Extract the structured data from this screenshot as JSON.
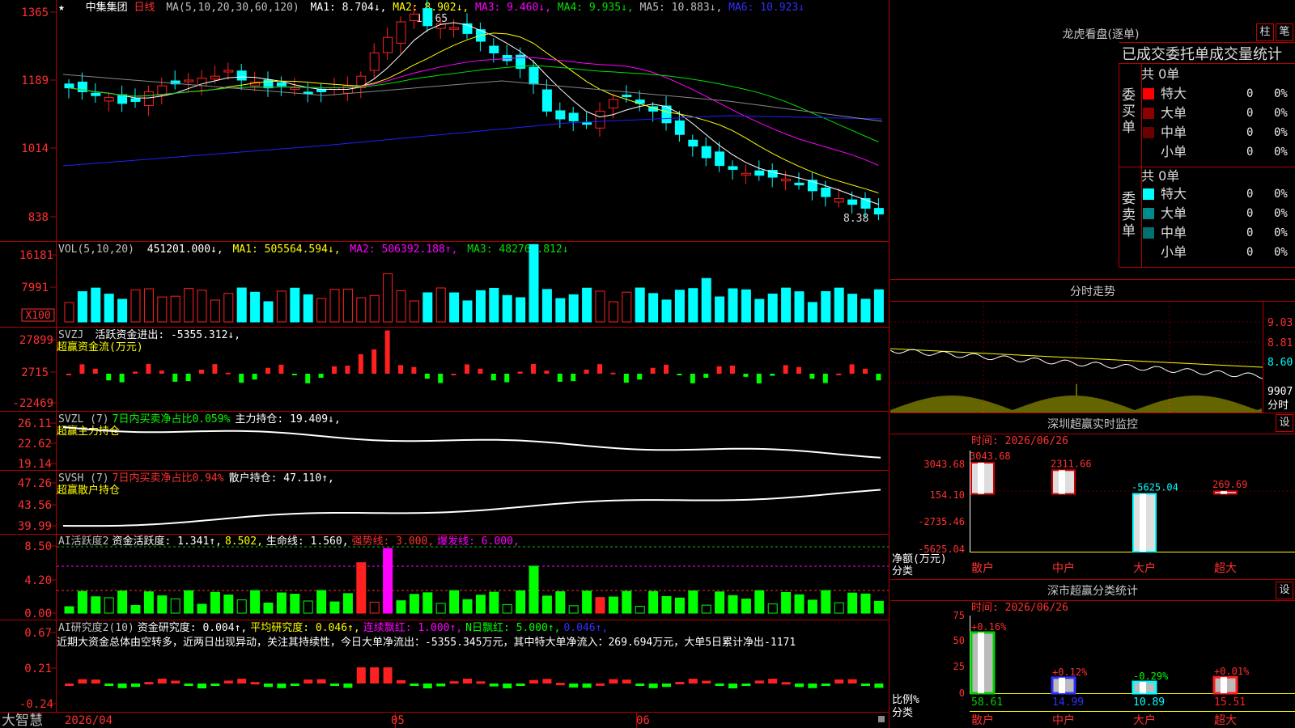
{
  "colors": {
    "up": "#ff2020",
    "down": "#00ffff",
    "grid": "#b00000",
    "ma1": "#ffffff",
    "ma2": "#ffff00",
    "ma3": "#ff00ff",
    "ma4": "#00e000",
    "ma6": "#2020ff",
    "green": "#00ff00",
    "yellow": "#ffff00",
    "magenta": "#ff00ff",
    "text": "#c0c0c0"
  },
  "main": {
    "star": "★",
    "stock_name": "中集集团",
    "period": "日线",
    "ma_params": "MA(5,10,20,30,60,120)",
    "ma": [
      {
        "label": "MA1: 8.704↓,"
      },
      {
        "label": "MA2: 8.902↓,"
      },
      {
        "label": "MA3: 9.460↓,"
      },
      {
        "label": "MA4: 9.935↓,"
      },
      {
        "label": "MA5: 10.883↓,"
      },
      {
        "label": "MA6: 10.923↓"
      }
    ],
    "high_label": "13.65",
    "low_label": "8.38",
    "yaxis": [
      "1365",
      "1189",
      "1014",
      "838"
    ]
  },
  "vol": {
    "title": "VOL(5,10,20)",
    "value": "451201.000↓,",
    "ma1": "MA1: 505564.594↓,",
    "ma2": "MA2: 506392.188↑,",
    "ma3": "MA3: 482765.812↓",
    "yaxis": [
      "16181",
      "7991"
    ],
    "unit": "X100"
  },
  "svzj": {
    "title": "SVZJ",
    "label": "活跃资金进出: -5355.312↓,",
    "sub": "超赢资金流(万元)",
    "yaxis": [
      "27899",
      "2715",
      "-22469"
    ]
  },
  "svzl": {
    "title": "SVZL (7)",
    "label": "7日内买卖净占比0.059%",
    "label2": "主力持仓: 19.409↓,",
    "sub": "超赢主力持仓",
    "yaxis": [
      "26.11",
      "22.62",
      "19.14"
    ]
  },
  "svsh": {
    "title": "SVSH (7)",
    "label": "7日内买卖净占比0.94%",
    "label2": "散户持仓: 47.110↑,",
    "sub": "超赢散户持仓",
    "yaxis": [
      "47.26",
      "43.56",
      "39.99"
    ]
  },
  "ai1": {
    "title": "AI活跃度2",
    "l1": "资金活跃度: 1.341↑,",
    "l2": "8.502,",
    "l3": "生命线: 1.560,",
    "l4": "强势线: 3.000,",
    "l5": "爆发线: 6.000,",
    "yaxis": [
      "8.50",
      "4.20",
      "0.00"
    ]
  },
  "ai2": {
    "title": "AI研究度2(10)",
    "l1": "资金研究度: 0.004↑,",
    "l2": "平均研究度: 0.046↑,",
    "l3": "连续飘红: 1.000↑,",
    "l4": "N日飘红: 5.000↑,",
    "l5": "0.046↑,",
    "note": "近期大资金总体由空转多，近两日出现异动，关注其持续性，今日大单净流出：-5355.345万元，其中特大单净流入：269.694万元，大单5日累计净出-1171",
    "yaxis": [
      "0.67",
      "0.21",
      "-0.24"
    ]
  },
  "xaxis": {
    "brand": "大智慧",
    "d1": "2026/04",
    "d2": "05",
    "d3": "06"
  },
  "lhb": {
    "title": "龙虎看盘(逐单)",
    "btn1": "柱",
    "btn2": "笔",
    "header": "已成交委托单成交量统计",
    "buy": {
      "side": "委买单",
      "total": "共 0单",
      "rows": [
        {
          "name": "特大",
          "v": "0",
          "p": "0%"
        },
        {
          "name": "大单",
          "v": "0",
          "p": "0%"
        },
        {
          "name": "中单",
          "v": "0",
          "p": "0%"
        },
        {
          "name": "小单",
          "v": "0",
          "p": "0%"
        }
      ]
    },
    "sell": {
      "side": "委卖单",
      "total": "共 0单",
      "rows": [
        {
          "name": "特大",
          "v": "0",
          "p": "0%"
        },
        {
          "name": "大单",
          "v": "0",
          "p": "0%"
        },
        {
          "name": "中单",
          "v": "0",
          "p": "0%"
        },
        {
          "name": "小单",
          "v": "0",
          "p": "0%"
        }
      ]
    }
  },
  "fenshi": {
    "title": "分时走势",
    "yaxis": [
      "9.03",
      "8.81",
      "8.60"
    ],
    "vol": "9907",
    "unit": "分时"
  },
  "monitor": {
    "title": "深圳超赢实时监控",
    "btn": "设",
    "date": "时间: 2026/06/26",
    "yaxis": [
      "3043.68",
      "154.10",
      "-2735.46",
      "-5625.04"
    ],
    "ylabel": "净额(万元)",
    "xlabel": "分类",
    "bars": [
      {
        "name": "散户",
        "value": "3043.68"
      },
      {
        "name": "中户",
        "value": "2311.66"
      },
      {
        "name": "大户",
        "value": "-5625.04"
      },
      {
        "name": "超大",
        "value": "269.69"
      }
    ]
  },
  "classify": {
    "title": "深市超赢分类统计",
    "btn": "设",
    "date": "时间: 2026/06/26",
    "yaxis": [
      "75",
      "50",
      "25",
      "0"
    ],
    "ylabel": "比例%",
    "xlabel": "分类",
    "bars": [
      {
        "name": "散户",
        "value": "58.61",
        "delta": "+0.16%"
      },
      {
        "name": "中户",
        "value": "14.99",
        "delta": "+0.12%"
      },
      {
        "name": "大户",
        "value": "10.89",
        "delta": "-0.29%"
      },
      {
        "name": "超大",
        "value": "15.51",
        "delta": "+0.01%"
      }
    ]
  }
}
